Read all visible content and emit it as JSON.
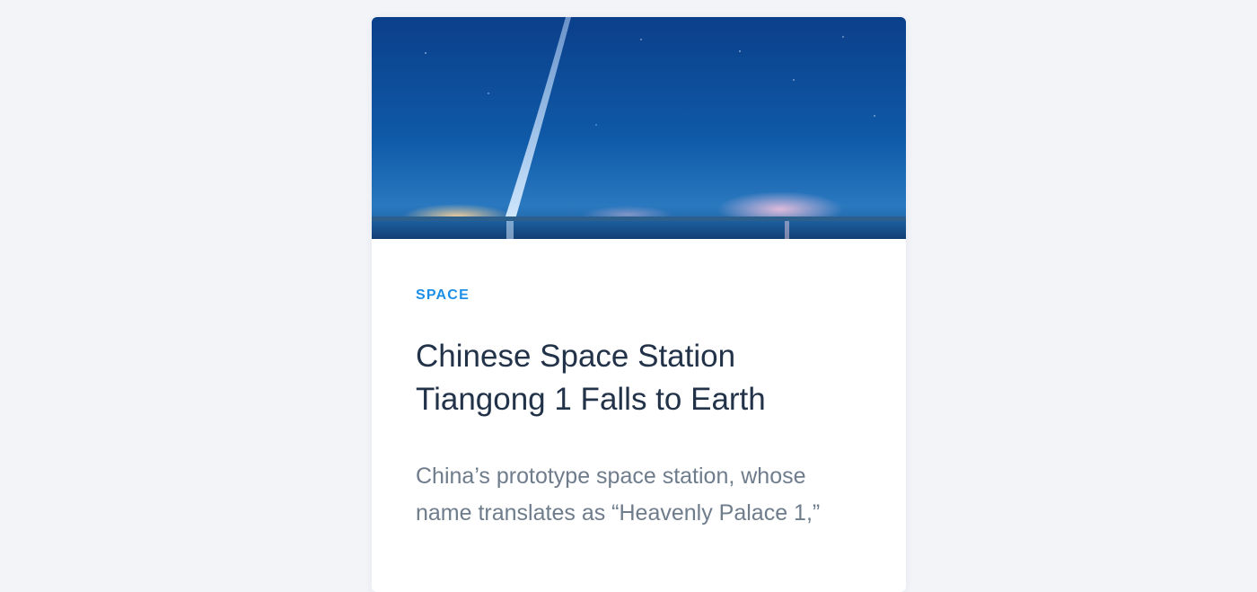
{
  "article": {
    "image_alt": "Night rocket launch trail over water",
    "category": "SPACE",
    "title_line1": "Chinese Space Station",
    "title_line2": "Tiangong 1 Falls to Earth",
    "excerpt_line1": "China’s prototype space station, whose",
    "excerpt_line2": "name translates as “Heavenly Palace 1,”"
  },
  "colors": {
    "page_background": "#f2f4f8",
    "card_background": "#ffffff",
    "category": "#1c8fe6",
    "title": "#223349",
    "excerpt": "#6e7c8c"
  }
}
